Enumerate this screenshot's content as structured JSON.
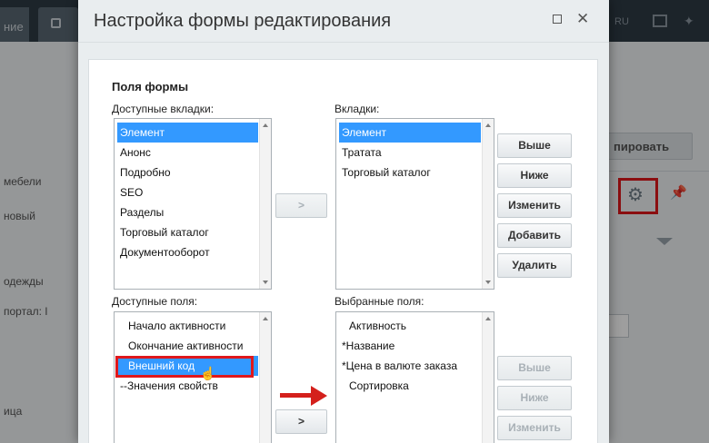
{
  "background": {
    "tab1_label": "ние",
    "lang": "RU",
    "sidebar_items": [
      "мебели",
      "новый",
      "одежды",
      "портал: I",
      "ица"
    ],
    "copy_button": "пировать"
  },
  "dialog": {
    "title": "Настройка формы редактирования",
    "section_title": "Поля формы",
    "available_tabs_label": "Доступные вкладки:",
    "available_tabs": [
      "Элемент",
      "Анонс",
      "Подробно",
      "SEO",
      "Разделы",
      "Торговый каталог",
      "Документооборот"
    ],
    "tabs_label": "Вкладки:",
    "tabs": [
      "Элемент",
      "Тратата",
      "Торговый каталог"
    ],
    "add_tab_button": ">",
    "tab_buttons": {
      "up": "Выше",
      "down": "Ниже",
      "edit": "Изменить",
      "add": "Добавить",
      "delete": "Удалить"
    },
    "available_fields_label": "Доступные поля:",
    "available_fields": [
      "Начало активности",
      "Окончание активности",
      "Внешний код",
      "--Значения свойств"
    ],
    "selected_fields_label": "Выбранные поля:",
    "selected_fields": [
      "Активность",
      "*Название",
      "*Цена в валюте заказа",
      "Сортировка"
    ],
    "add_field_button": ">",
    "field_buttons": {
      "up": "Выше",
      "down": "Ниже",
      "edit": "Изменить"
    }
  },
  "colors": {
    "accent_select": "#3399ff",
    "highlight_red": "#e0181b"
  }
}
